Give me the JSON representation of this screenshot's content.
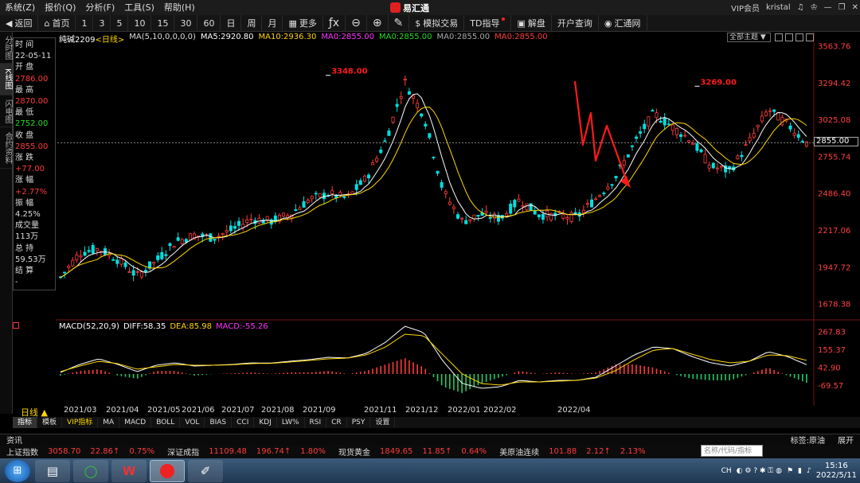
{
  "menu": [
    "系统(Z)",
    "报价(Q)",
    "分析(F)",
    "工具(S)",
    "帮助(H)"
  ],
  "app_name": "易汇通",
  "window": {
    "vip_label": "VIP会员",
    "user": "kristal"
  },
  "toolbar": {
    "back": "返回",
    "home": "首页",
    "periods": [
      "1",
      "3",
      "5",
      "10",
      "15",
      "30",
      "60",
      "日",
      "周",
      "月"
    ],
    "more": "更多",
    "sim_trade": "模拟交易",
    "td_guide": "TD指导",
    "commentary": "解盘",
    "open_account": "开户查询",
    "huitong": "汇通网"
  },
  "left_tabs": [
    "分时图",
    "K线图",
    "闪电图",
    "合约资料"
  ],
  "info_panel": [
    {
      "label": "时 间",
      "value": "22-05-11",
      "color": "white"
    },
    {
      "label": "开 盘",
      "value": "2786.00",
      "color": "red"
    },
    {
      "label": "最 高",
      "value": "2870.00",
      "color": "red"
    },
    {
      "label": "最 低",
      "value": "2752.00",
      "color": "green"
    },
    {
      "label": "收 盘",
      "value": "2855.00",
      "color": "red"
    },
    {
      "label": "涨 跌",
      "value": "+77.00",
      "color": "red"
    },
    {
      "label": "涨 幅",
      "value": "+2.77%",
      "color": "red"
    },
    {
      "label": "振 幅",
      "value": "4.25%",
      "color": "white"
    },
    {
      "label": "成交量",
      "value": "113万",
      "color": "white"
    },
    {
      "label": "总 持",
      "value": "59.53万",
      "color": "white"
    },
    {
      "label": "结 算",
      "value": "-",
      "color": "white"
    }
  ],
  "legend": {
    "symbol": "纯碱2209",
    "period": "<日线>",
    "ma_set": "MA(5,10,0,0,0,0)",
    "items": [
      {
        "text": "MA5:2920.80",
        "color": "#ffffff"
      },
      {
        "text": "MA10:2936.30",
        "color": "#ffd700"
      },
      {
        "text": "MA0:2855.00",
        "color": "#ff33ff"
      },
      {
        "text": "MA0:2855.00",
        "color": "#22dd22"
      },
      {
        "text": "MA0:2855.00",
        "color": "#aaaaaa"
      },
      {
        "text": "MA0:2855.00",
        "color": "#ff3b3b"
      }
    ]
  },
  "all_main": "全部主题",
  "current_price": "2855.00",
  "macd_legend": {
    "name": "MACD(52,20,9)",
    "diff": "DIFF:58.35",
    "dea": "DEA:85.98",
    "macd": "MACD:-55.26"
  },
  "period_label": "日线",
  "bottom_tabs": [
    "指标",
    "模板",
    "VIP指标",
    "MA",
    "MACD",
    "BOLL",
    "VOL",
    "BIAS",
    "CCI",
    "KDJ",
    "LW%",
    "RSI",
    "CR",
    "PSY",
    "设置"
  ],
  "news_bar": {
    "left": "资讯",
    "tag": "标签:原油",
    "expand": "展开"
  },
  "ticker": [
    {
      "name": "上证指数",
      "price": "3058.70",
      "chg": "22.86↑",
      "pct": "0.75%"
    },
    {
      "name": "深证成指",
      "price": "11109.48",
      "chg": "196.74↑",
      "pct": "1.80%"
    },
    {
      "name": "现货黄金",
      "price": "1849.65",
      "chg": "11.85↑",
      "pct": "0.64%"
    },
    {
      "name": "美原油连续",
      "price": "101.88",
      "chg": "2.12↑",
      "pct": "2.13%"
    }
  ],
  "search_placeholder": "名称/代码/指标",
  "clock": {
    "time": "15:16",
    "date": "2022/5/11"
  },
  "tray_lang": "CH",
  "colors": {
    "up": "#ff3b3b",
    "down": "#22dd22",
    "ma5": "#ffffff",
    "ma10": "#ffd700",
    "annot": "#ff1a1a"
  },
  "chart_data": {
    "type": "candlestick",
    "symbol": "纯碱2209",
    "ylim": [
      1600,
      3620
    ],
    "y_ticks": [
      3563.76,
      3294.42,
      3025.08,
      2755.74,
      2486.4,
      2217.06,
      1947.72,
      1678.38
    ],
    "x_labels": [
      "2021/03",
      "2021/04",
      "2021/05",
      "2021/06",
      "2021/07",
      "2021/08",
      "2021/09",
      "2021/11",
      "2021/12",
      "2022/01",
      "2022/02",
      "2022/04"
    ],
    "annotations": [
      {
        "label": "3348.00"
      },
      {
        "label": "3269.00"
      }
    ],
    "current_price": 2855.0,
    "close_path": [
      1870,
      2050,
      2080,
      2000,
      1880,
      1990,
      2130,
      2180,
      2160,
      2220,
      2300,
      2280,
      2330,
      2440,
      2480,
      2450,
      2600,
      2870,
      3300,
      3050,
      2500,
      2280,
      2330,
      2300,
      2440,
      2330,
      2320,
      2310,
      2450,
      2600,
      2850,
      3070,
      2970,
      2870,
      2680,
      2650,
      2860,
      3100,
      2990,
      2855
    ],
    "macd": {
      "ylim": [
        -150,
        300
      ],
      "y_ticks": [
        267.83,
        155.37,
        42.9,
        -69.57
      ],
      "diff": [
        10,
        60,
        95,
        60,
        15,
        55,
        70,
        50,
        55,
        60,
        70,
        68,
        80,
        90,
        105,
        100,
        130,
        200,
        300,
        260,
        80,
        -60,
        -90,
        -80,
        -40,
        -50,
        -40,
        -40,
        -20,
        50,
        120,
        170,
        160,
        110,
        70,
        50,
        80,
        140,
        110,
        58.35
      ],
      "dea": [
        15,
        50,
        80,
        65,
        30,
        45,
        60,
        55,
        55,
        58,
        65,
        67,
        75,
        85,
        95,
        100,
        120,
        170,
        250,
        240,
        120,
        0,
        -60,
        -70,
        -50,
        -50,
        -45,
        -40,
        -25,
        20,
        90,
        150,
        160,
        125,
        90,
        70,
        80,
        120,
        115,
        85.98
      ]
    }
  }
}
